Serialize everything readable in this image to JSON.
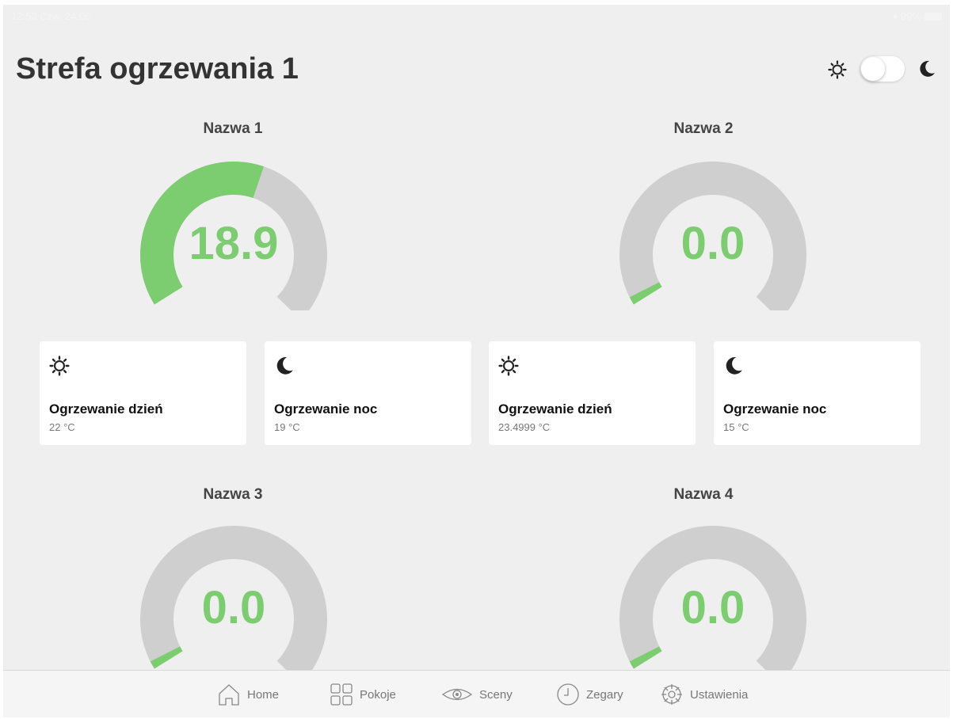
{
  "status_bar": {
    "time_date": "12:53 Czw. 24.06",
    "battery": "99%"
  },
  "header": {
    "title": "Strefa ogrzewania 1",
    "mode_toggle": {
      "day_icon": "sun-icon",
      "night_icon": "moon-icon",
      "state": "day"
    }
  },
  "zones": [
    {
      "name": "Nazwa 1",
      "value": "18.9",
      "fill_fraction": 0.55,
      "day": {
        "title": "Ogrzewanie dzień",
        "value": "22 °C"
      },
      "night": {
        "title": "Ogrzewanie noc",
        "value": "19 °C"
      }
    },
    {
      "name": "Nazwa 2",
      "value": "0.0",
      "fill_fraction": 0.02,
      "day": {
        "title": "Ogrzewanie dzień",
        "value": "23.4999 °C"
      },
      "night": {
        "title": "Ogrzewanie noc",
        "value": "15 °C"
      }
    },
    {
      "name": "Nazwa 3",
      "value": "0.0",
      "fill_fraction": 0.02
    },
    {
      "name": "Nazwa 4",
      "value": "0.0",
      "fill_fraction": 0.02
    }
  ],
  "colors": {
    "accent": "#7ccd6f",
    "track": "#cfcfcf",
    "background": "#efefef"
  },
  "tab_bar": {
    "items": [
      {
        "label": "Home",
        "icon": "home-icon"
      },
      {
        "label": "Pokoje",
        "icon": "rooms-grid-icon"
      },
      {
        "label": "Sceny",
        "icon": "eye-icon"
      },
      {
        "label": "Zegary",
        "icon": "clock-icon"
      },
      {
        "label": "Ustawienia",
        "icon": "settings-gear-icon"
      }
    ]
  }
}
